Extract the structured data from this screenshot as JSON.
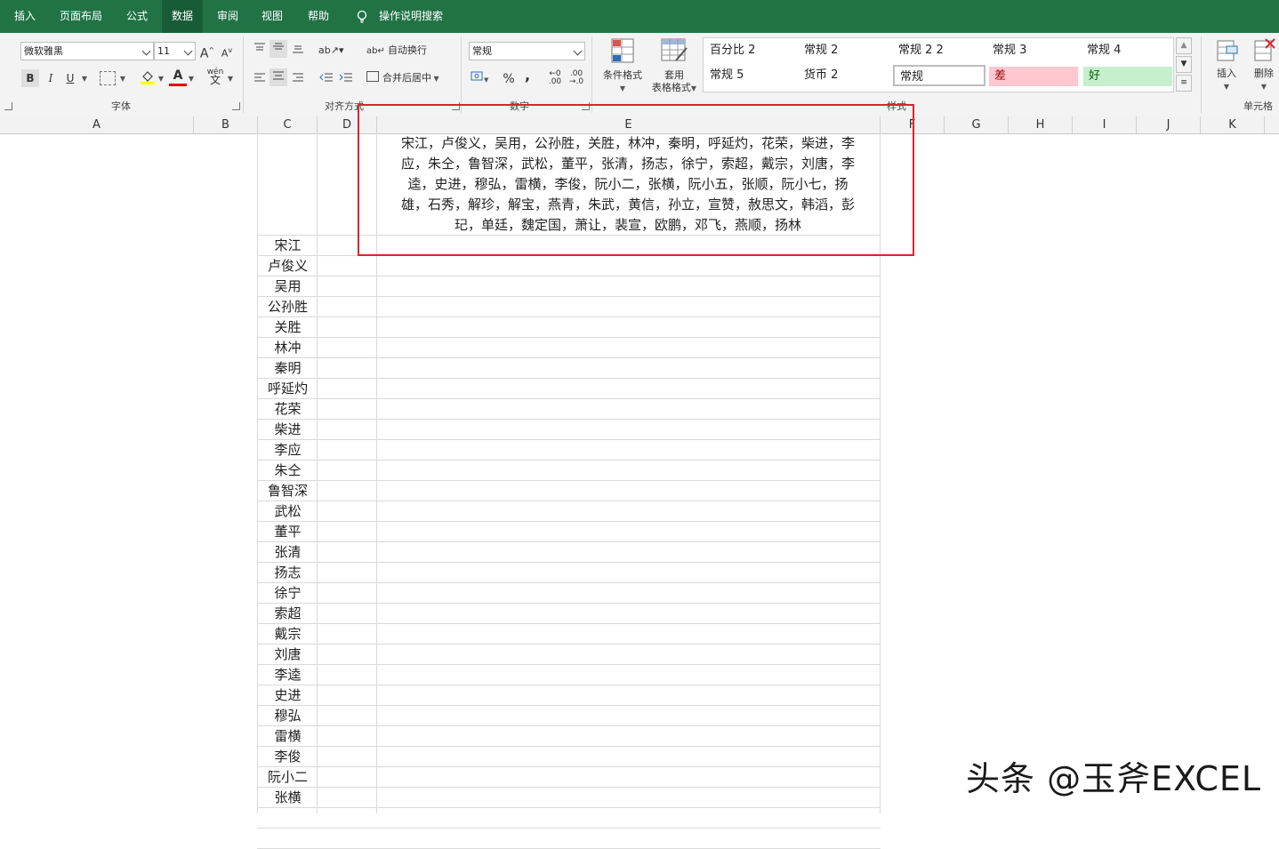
{
  "menu_tabs": [
    "插入",
    "页面布局",
    "公式",
    "数据",
    "审阅",
    "视图",
    "帮助",
    "操作说明搜索"
  ],
  "ribbon": {
    "font_name": "微软雅黑",
    "font_size": "11",
    "font_group_label": "字体",
    "align_group_label": "对齐方式",
    "number_group_label": "数字",
    "styles_group_label": "样式",
    "cells_group_label": "单元格",
    "wrap_text": "自动换行",
    "merge_center": "合并后居中",
    "number_format": "常规",
    "percent": "%",
    "comma": ",",
    "cond_format": "条件格式",
    "table_format_1": "套用",
    "table_format_2": "表格格式",
    "insert": "插入",
    "delete": "删除",
    "bold": "B",
    "italic": "I",
    "underline": "U",
    "font_color_letter": "A",
    "grow_font": "A",
    "shrink_font": "A",
    "phonetic": "wén",
    "phonetic_glyph": "文",
    "styles": [
      {
        "label": "百分比 2"
      },
      {
        "label": "常规 2"
      },
      {
        "label": "常规 2 2"
      },
      {
        "label": "常规 3"
      },
      {
        "label": "常规 4"
      },
      {
        "label": "常规 5"
      },
      {
        "label": "货币 2"
      },
      {
        "label": "常规"
      },
      {
        "label": "差"
      },
      {
        "label": "好"
      }
    ],
    "colors": {
      "bad_fill": "#ffc7ce",
      "bad_text": "#9c0006",
      "good_fill": "#c6efce",
      "good_text": "#006100"
    }
  },
  "columns": [
    "A",
    "B",
    "C",
    "D",
    "E",
    "F",
    "G",
    "H",
    "I",
    "J",
    "K"
  ],
  "merged_text_lines": [
    "宋江，卢俊义，吴用，公孙胜，关胜，林冲，秦明，呼延灼，花荣，柴进，李",
    "应，朱仝，鲁智深，武松，董平，张清，扬志，徐宁，索超，戴宗，刘唐，李",
    "逵，史进，穆弘，雷横，李俊，阮小二，张横，阮小五，张顺，阮小七，扬",
    "雄，石秀，解珍，解宝，燕青，朱武，黄信，孙立，宣赞，赦思文，韩滔，彭",
    "玘，单廷，魏定国，萧让，裴宣，欧鹏，邓飞，燕顺，扬林"
  ],
  "names": [
    "宋江",
    "卢俊义",
    "吴用",
    "公孙胜",
    "关胜",
    "林冲",
    "秦明",
    "呼延灼",
    "花荣",
    "柴进",
    "李应",
    "朱仝",
    "鲁智深",
    "武松",
    "董平",
    "张清",
    "扬志",
    "徐宁",
    "索超",
    "戴宗",
    "刘唐",
    "李逵",
    "史进",
    "穆弘",
    "雷横",
    "李俊",
    "阮小二",
    "张横"
  ],
  "watermark": "头条 @玉斧EXCEL",
  "highlight_color": "#d9242f",
  "menubar_color": "#217346"
}
